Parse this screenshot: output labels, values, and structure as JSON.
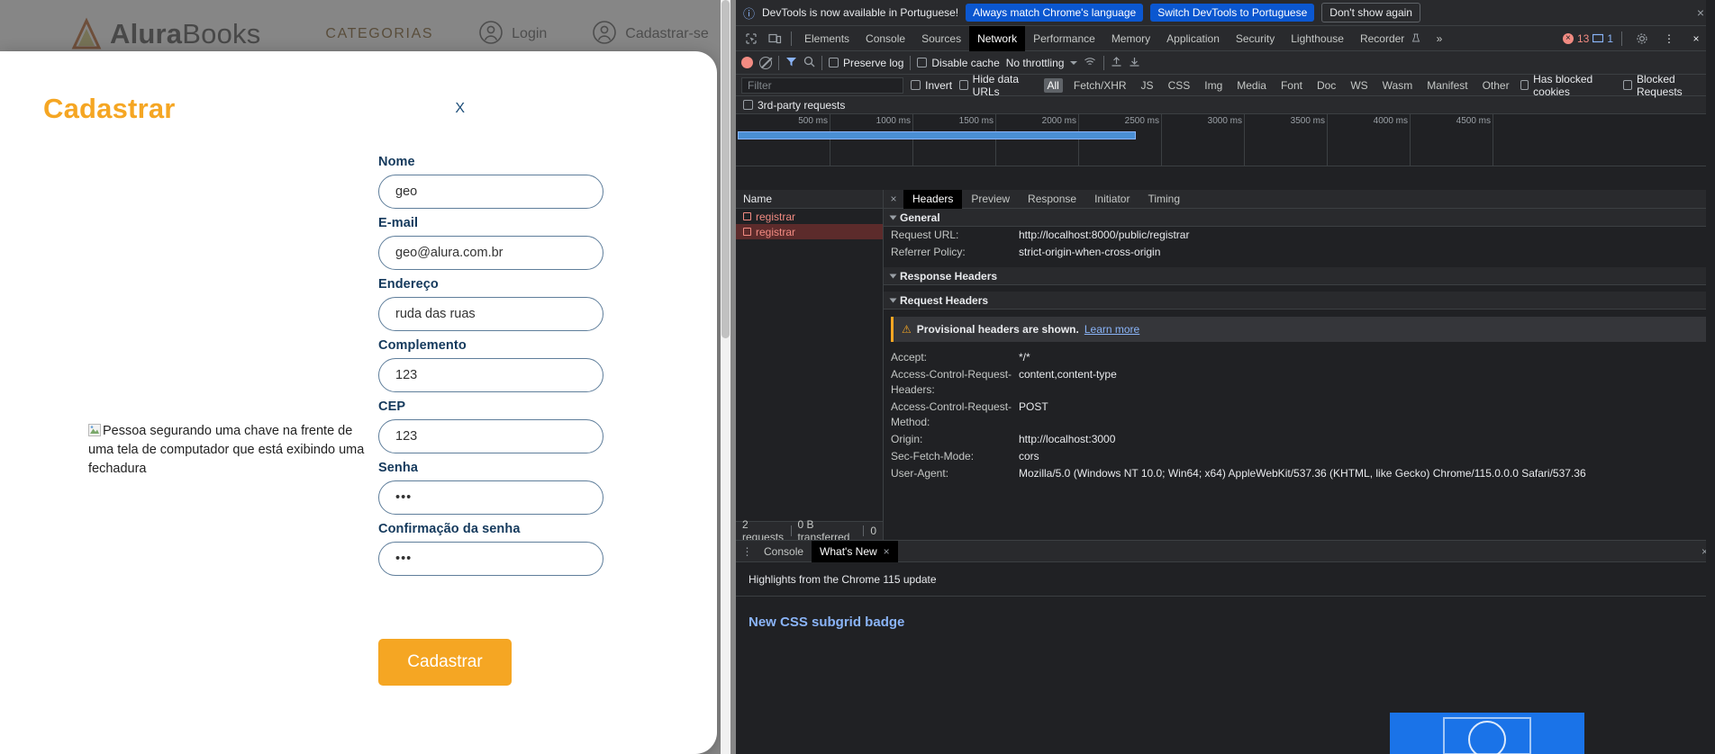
{
  "site": {
    "brand_bold": "Alura",
    "brand_light": "Books",
    "nav": {
      "categorias": "CATEGORIAS",
      "login": "Login",
      "cadastrar": "Cadastrar-se"
    },
    "accent_color": "#f5a623"
  },
  "modal": {
    "title": "Cadastrar",
    "close_label": "X",
    "image_alt": "Pessoa segurando uma chave na frente de uma tela de computador que está exibindo uma fechadura",
    "submit_label": "Cadastrar",
    "fields": [
      {
        "label": "Nome",
        "value": "geo",
        "type": "text"
      },
      {
        "label": "E-mail",
        "value": "geo@alura.com.br",
        "type": "text"
      },
      {
        "label": "Endereço",
        "value": "ruda das ruas",
        "type": "text"
      },
      {
        "label": "Complemento",
        "value": "123",
        "type": "text"
      },
      {
        "label": "CEP",
        "value": "123",
        "type": "text"
      },
      {
        "label": "Senha",
        "value": "•••",
        "type": "password"
      },
      {
        "label": "Confirmação da senha",
        "value": "•••",
        "type": "password"
      }
    ]
  },
  "devtools": {
    "banner": {
      "message": "DevTools is now available in Portuguese!",
      "primary_button": "Always match Chrome's language",
      "secondary_button": "Switch DevTools to Portuguese",
      "dismiss_button": "Don't show again",
      "close_icon": "×",
      "info_icon": "info-icon"
    },
    "tabs": [
      {
        "label": "Elements",
        "active": false
      },
      {
        "label": "Console",
        "active": false
      },
      {
        "label": "Sources",
        "active": false
      },
      {
        "label": "Network",
        "active": true
      },
      {
        "label": "Performance",
        "active": false
      },
      {
        "label": "Memory",
        "active": false
      },
      {
        "label": "Application",
        "active": false
      },
      {
        "label": "Security",
        "active": false
      },
      {
        "label": "Lighthouse",
        "active": false
      },
      {
        "label": "Recorder",
        "active": false
      }
    ],
    "overflow_label": "»",
    "error_count": "13",
    "message_count": "1",
    "network_toolbar": {
      "preserve_log": "Preserve log",
      "disable_cache": "Disable cache",
      "throttling": "No throttling",
      "record_icon": "record-icon",
      "clear_icon": "clear-icon",
      "filter_icon": "filter-icon",
      "search_icon": "search-icon",
      "import_icon": "import-har-icon",
      "export_icon": "export-har-icon",
      "settings_icon": "gear-icon"
    },
    "filter_bar": {
      "placeholder": "Filter",
      "invert": "Invert",
      "hide_data_urls": "Hide data URLs",
      "types": [
        {
          "label": "All",
          "selected": true
        },
        {
          "label": "Fetch/XHR",
          "selected": false
        },
        {
          "label": "JS",
          "selected": false
        },
        {
          "label": "CSS",
          "selected": false
        },
        {
          "label": "Img",
          "selected": false
        },
        {
          "label": "Media",
          "selected": false
        },
        {
          "label": "Font",
          "selected": false
        },
        {
          "label": "Doc",
          "selected": false
        },
        {
          "label": "WS",
          "selected": false
        },
        {
          "label": "Wasm",
          "selected": false
        },
        {
          "label": "Manifest",
          "selected": false
        },
        {
          "label": "Other",
          "selected": false
        }
      ],
      "has_blocked_cookies": "Has blocked cookies",
      "blocked_requests": "Blocked Requests",
      "third_party": "3rd-party requests"
    },
    "timeline_ticks": [
      "500 ms",
      "1000 ms",
      "1500 ms",
      "2000 ms",
      "2500 ms",
      "3000 ms",
      "3500 ms",
      "4000 ms",
      "4500 ms"
    ],
    "request_list": {
      "column_name": "Name",
      "rows": [
        {
          "name": "registrar",
          "selected": false
        },
        {
          "name": "registrar",
          "selected": true
        }
      ]
    },
    "detail_tabs": [
      {
        "label": "Headers",
        "active": true
      },
      {
        "label": "Preview",
        "active": false
      },
      {
        "label": "Response",
        "active": false
      },
      {
        "label": "Initiator",
        "active": false
      },
      {
        "label": "Timing",
        "active": false
      }
    ],
    "sections": {
      "general_title": "General",
      "general": [
        {
          "key": "Request URL:",
          "value": "http://localhost:8000/public/registrar"
        },
        {
          "key": "Referrer Policy:",
          "value": "strict-origin-when-cross-origin"
        }
      ],
      "response_headers_title": "Response Headers",
      "request_headers_title": "Request Headers",
      "provisional_warning": "Provisional headers are shown.",
      "provisional_link": "Learn more",
      "request_headers": [
        {
          "key": "Accept:",
          "value": "*/*"
        },
        {
          "key": "Access-Control-Request-Headers:",
          "value": "content,content-type"
        },
        {
          "key": "Access-Control-Request-Method:",
          "value": "POST"
        },
        {
          "key": "Origin:",
          "value": "http://localhost:3000"
        },
        {
          "key": "Sec-Fetch-Mode:",
          "value": "cors"
        },
        {
          "key": "User-Agent:",
          "value": "Mozilla/5.0 (Windows NT 10.0; Win64; x64) AppleWebKit/537.36 (KHTML, like Gecko) Chrome/115.0.0.0 Safari/537.36"
        }
      ]
    },
    "status_bar": {
      "requests": "2 requests",
      "transferred": "0 B transferred",
      "resources": "0"
    },
    "drawer": {
      "console_tab": "Console",
      "whatsnew_tab": "What's New",
      "close_icon": "×",
      "subtitle": "Highlights from the Chrome 115 update",
      "article_title": "New CSS subgrid badge"
    }
  }
}
